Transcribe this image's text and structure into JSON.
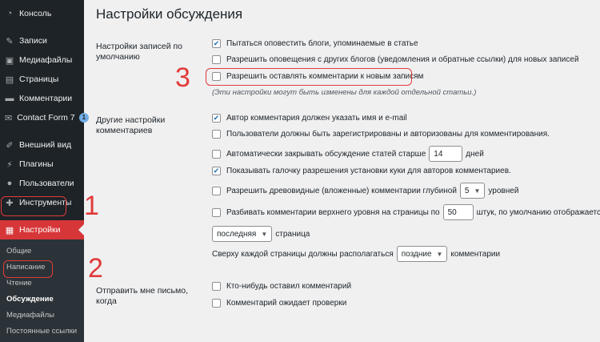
{
  "sidebar": {
    "items": [
      {
        "label": "Консоль",
        "icon": "dashboard-icon"
      },
      {
        "label": "Записи",
        "icon": "pin-icon"
      },
      {
        "label": "Медиафайлы",
        "icon": "media-icon"
      },
      {
        "label": "Страницы",
        "icon": "pages-icon"
      },
      {
        "label": "Комментарии",
        "icon": "comments-icon"
      },
      {
        "label": "Contact Form 7",
        "icon": "mail-icon",
        "badge": "1"
      },
      {
        "label": "Внешний вид",
        "icon": "brush-icon"
      },
      {
        "label": "Плагины",
        "icon": "plugins-icon"
      },
      {
        "label": "Пользователи",
        "icon": "users-icon"
      },
      {
        "label": "Инструменты",
        "icon": "tools-icon"
      },
      {
        "label": "Настройки",
        "icon": "settings-icon"
      }
    ],
    "submenu": [
      "Общие",
      "Написание",
      "Чтение",
      "Обсуждение",
      "Медиафайлы",
      "Постоянные ссылки"
    ]
  },
  "page": {
    "title": "Настройки обсуждения",
    "section1": {
      "label": "Настройки записей по умолчанию",
      "options": [
        {
          "text": "Пытаться оповестить блоги, упоминаемые в статье",
          "checked": true
        },
        {
          "text": "Разрешить оповещения с других блогов (уведомления и обратные ссылки) для новых записей",
          "checked": false
        },
        {
          "text": "Разрешить оставлять комментарии к новым записям",
          "checked": false
        }
      ],
      "note": "(Эти настройки могут быть изменены для каждой отдельной статьи.)"
    },
    "section2": {
      "label": "Другие настройки комментариев",
      "author": "Автор комментария должен указать имя и e-mail",
      "registered": "Пользователи должны быть зарегистрированы и авторизованы для комментирования.",
      "close_pre": "Автоматически закрывать обсуждение статей старше",
      "close_days": "14",
      "close_post": "дней",
      "cookies": "Показывать галочку разрешения установки куки для авторов комментариев.",
      "threaded_pre": "Разрешить древовидные (вложенные) комментарии глубиной",
      "threaded_depth": "5",
      "threaded_post": "уровней",
      "paged_pre": "Разбивать комментарии верхнего уровня на страницы по",
      "paged_count": "50",
      "paged_post": "штук, по умолчанию отображается",
      "paged_which": "последняя",
      "paged_suffix": "страница",
      "top_pre": "Сверху каждой страницы должны располагаться",
      "top_order": "поздние",
      "top_post": "комментарии"
    },
    "section3": {
      "label": "Отправить мне письмо, когда",
      "options": [
        "Кто-нибудь оставил комментарий",
        "Комментарий ожидает проверки"
      ]
    }
  },
  "annotations": {
    "one": "1",
    "two": "2",
    "three": "3",
    "color": "#e23a3a"
  }
}
